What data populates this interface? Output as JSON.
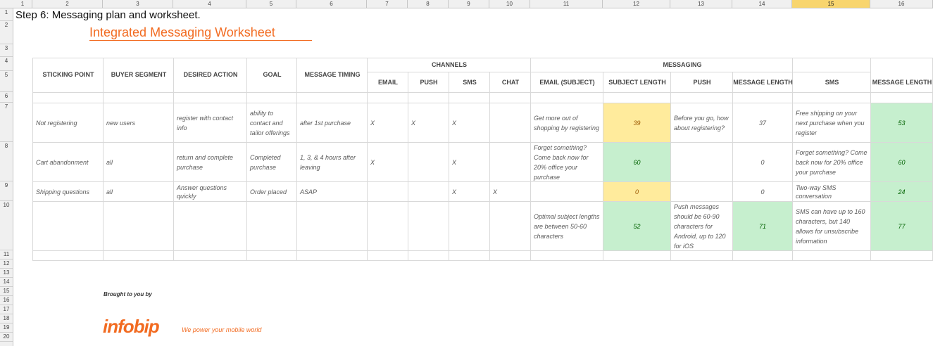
{
  "column_headers": [
    "1",
    "2",
    "3",
    "4",
    "5",
    "6",
    "7",
    "8",
    "9",
    "10",
    "11",
    "12",
    "13",
    "14",
    "15",
    "16"
  ],
  "selected_column": "15",
  "row_headers": [
    "1",
    "2",
    "3",
    "4",
    "5",
    "6",
    "7",
    "8",
    "9",
    "10",
    "11",
    "12",
    "13",
    "14",
    "15",
    "16",
    "17",
    "18",
    "19",
    "20"
  ],
  "step_title": "Step 6: Messaging plan and worksheet.",
  "worksheet_title": "Integrated Messaging Worksheet",
  "headers": {
    "sticking_point": "STICKING POINT",
    "buyer_segment": "BUYER SEGMENT",
    "desired_action": "DESIRED ACTION",
    "goal": "GOAL",
    "message_timing": "MESSAGE TIMING",
    "channels": "CHANNELS",
    "email": "EMAIL",
    "push": "PUSH",
    "sms": "SMS",
    "chat": "CHAT",
    "messaging": "MESSAGING",
    "email_subject": "EMAIL (SUBJECT)",
    "subject_length": "SUBJECT LENGTH",
    "push_msg": "PUSH",
    "message_length": "MESSAGE LENGTH",
    "sms_msg": "SMS",
    "message_length2": "MESSAGE LENGTH"
  },
  "rows": [
    {
      "sticking_point": "Not registering",
      "buyer_segment": "new users",
      "desired_action": "register with contact info",
      "goal": "ability to contact and tailor offerings",
      "timing": "after 1st purchase",
      "email": "X",
      "push": "X",
      "sms": "X",
      "chat": "",
      "email_subject": "Get more out of shopping by registering",
      "subject_length": "39",
      "push_msg": "Before you go, how about registering?",
      "push_length": "37",
      "sms_msg": "Free shipping on your next purchase when you register",
      "sms_length": "53"
    },
    {
      "sticking_point": "Cart abandonment",
      "buyer_segment": "all",
      "desired_action": "return and complete purchase",
      "goal": "Completed purchase",
      "timing": "1, 3, & 4 hours after leaving",
      "email": "X",
      "push": "",
      "sms": "X",
      "chat": "",
      "email_subject": "Forget something? Come back now for 20% office your purchase",
      "subject_length": "60",
      "push_msg": "",
      "push_length": "0",
      "sms_msg": "Forget something? Come back now for 20% office your purchase",
      "sms_length": "60"
    },
    {
      "sticking_point": "Shipping questions",
      "buyer_segment": "all",
      "desired_action": "Answer questions quickly",
      "goal": "Order placed",
      "timing": "ASAP",
      "email": "",
      "push": "",
      "sms": "X",
      "chat": "X",
      "email_subject": "",
      "subject_length": "0",
      "push_msg": "",
      "push_length": "0",
      "sms_msg": "Two-way SMS conversation",
      "sms_length": "24"
    },
    {
      "sticking_point": "",
      "buyer_segment": "",
      "desired_action": "",
      "goal": "",
      "timing": "",
      "email": "",
      "push": "",
      "sms": "",
      "chat": "",
      "email_subject": "Optimal subject lengths are between 50-60 characters",
      "subject_length": "52",
      "push_msg": "Push messages should be 60-90 characters for Android, up to 120 for iOS",
      "push_length": "71",
      "sms_msg": "SMS can have up to 160 characters, but 140 allows for unsubscribe information",
      "sms_length": "77"
    }
  ],
  "footer": {
    "brought_by": "Brought to you by",
    "logo": "infobip",
    "tagline": "We power your mobile world"
  },
  "colors": {
    "accent_orange": "#f26b21",
    "yellow_fill": "#ffeb9c",
    "green_fill": "#c6efce",
    "selected_header": "#f8d56e"
  }
}
